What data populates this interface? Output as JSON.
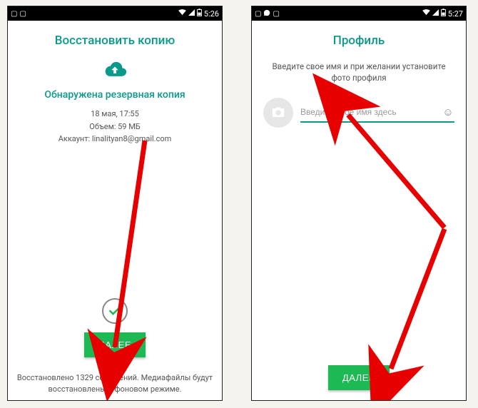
{
  "left": {
    "status": {
      "time": "5:26"
    },
    "title": "Восстановить копию",
    "backup_found": "Обнаружена резервная копия",
    "date": "18 мая, 17:55",
    "size": "Объем: 59 МБ",
    "account": "Аккаунт: linalityan8@gmail.com",
    "next_btn": "ДАЛЕЕ",
    "restored_msg": "Восстановлено 1329 сообщений. Медиафайлы будут восстановлены в фоновом режиме."
  },
  "right": {
    "status": {
      "time": "5:27"
    },
    "title": "Профиль",
    "subtitle": "Введите свое имя и при желании установите фото профиля",
    "name_placeholder": "Введите свое имя здесь",
    "next_btn": "ДАЛЕЕ"
  }
}
